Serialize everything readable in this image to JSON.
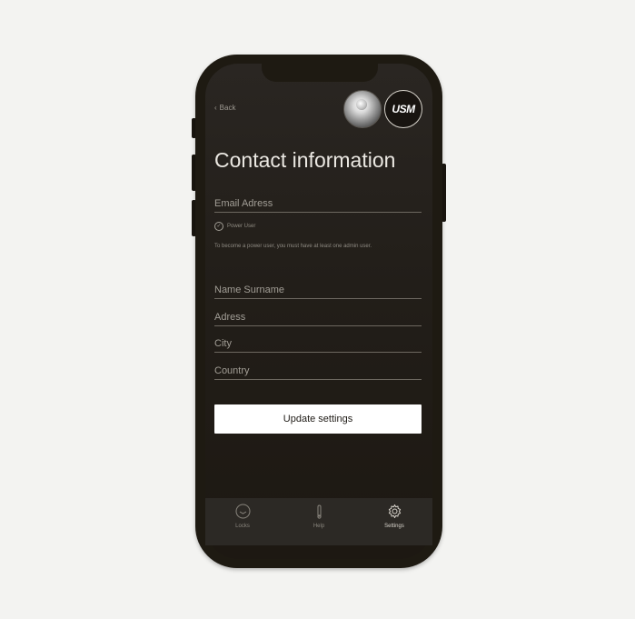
{
  "header": {
    "back_label": "Back",
    "logo_text": "USM"
  },
  "page": {
    "title": "Contact information"
  },
  "form": {
    "email_placeholder": "Email Adress",
    "power_user_label": "Power User",
    "power_user_hint": "To become a power user, you must have at least one admin user.",
    "name_placeholder": "Name Surname",
    "address_placeholder": "Adress",
    "city_placeholder": "City",
    "country_placeholder": "Country",
    "update_button": "Update settings"
  },
  "tabbar": {
    "items": [
      {
        "label": "Locks",
        "icon": "lock-circle-icon"
      },
      {
        "label": "Help",
        "icon": "info-icon"
      },
      {
        "label": "Settings",
        "icon": "gear-icon",
        "active": true
      }
    ]
  },
  "colors": {
    "background": "#f3f3f1",
    "phone_frame": "#1e1a12",
    "screen": "#221e19",
    "text_primary": "#ebe8e2",
    "text_muted": "#a29e96",
    "button_bg": "#ffffff"
  }
}
